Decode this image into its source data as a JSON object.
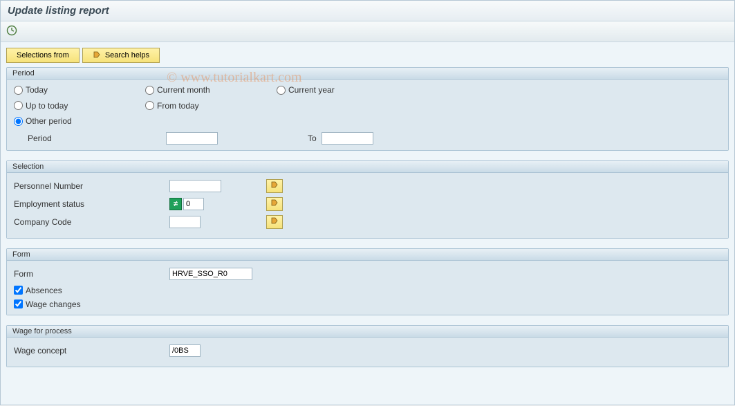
{
  "window": {
    "title": "Update listing report"
  },
  "watermark": "© www.tutorialkart.com",
  "actions": {
    "selections_from": "Selections from",
    "search_helps": "Search helps"
  },
  "period_group": {
    "title": "Period",
    "today": "Today",
    "current_month": "Current month",
    "current_year": "Current year",
    "up_to_today": "Up to today",
    "from_today": "From today",
    "other_period": "Other period",
    "period_lbl": "Period",
    "to_lbl": "To",
    "selected": "other_period",
    "period_from": "",
    "period_to": ""
  },
  "selection_group": {
    "title": "Selection",
    "personnel_number_lbl": "Personnel Number",
    "employment_status_lbl": "Employment status",
    "company_code_lbl": "Company Code",
    "personnel_number": "",
    "employment_status_op": "≠",
    "employment_status_val": "0",
    "company_code": ""
  },
  "form_group": {
    "title": "Form",
    "form_lbl": "Form",
    "form_val": "HRVE_SSO_R0",
    "absences_lbl": "Absences",
    "absences_checked": true,
    "wage_changes_lbl": "Wage changes",
    "wage_changes_checked": true
  },
  "wage_group": {
    "title": "Wage for process",
    "wage_concept_lbl": "Wage concept",
    "wage_concept_val": "/0BS"
  }
}
